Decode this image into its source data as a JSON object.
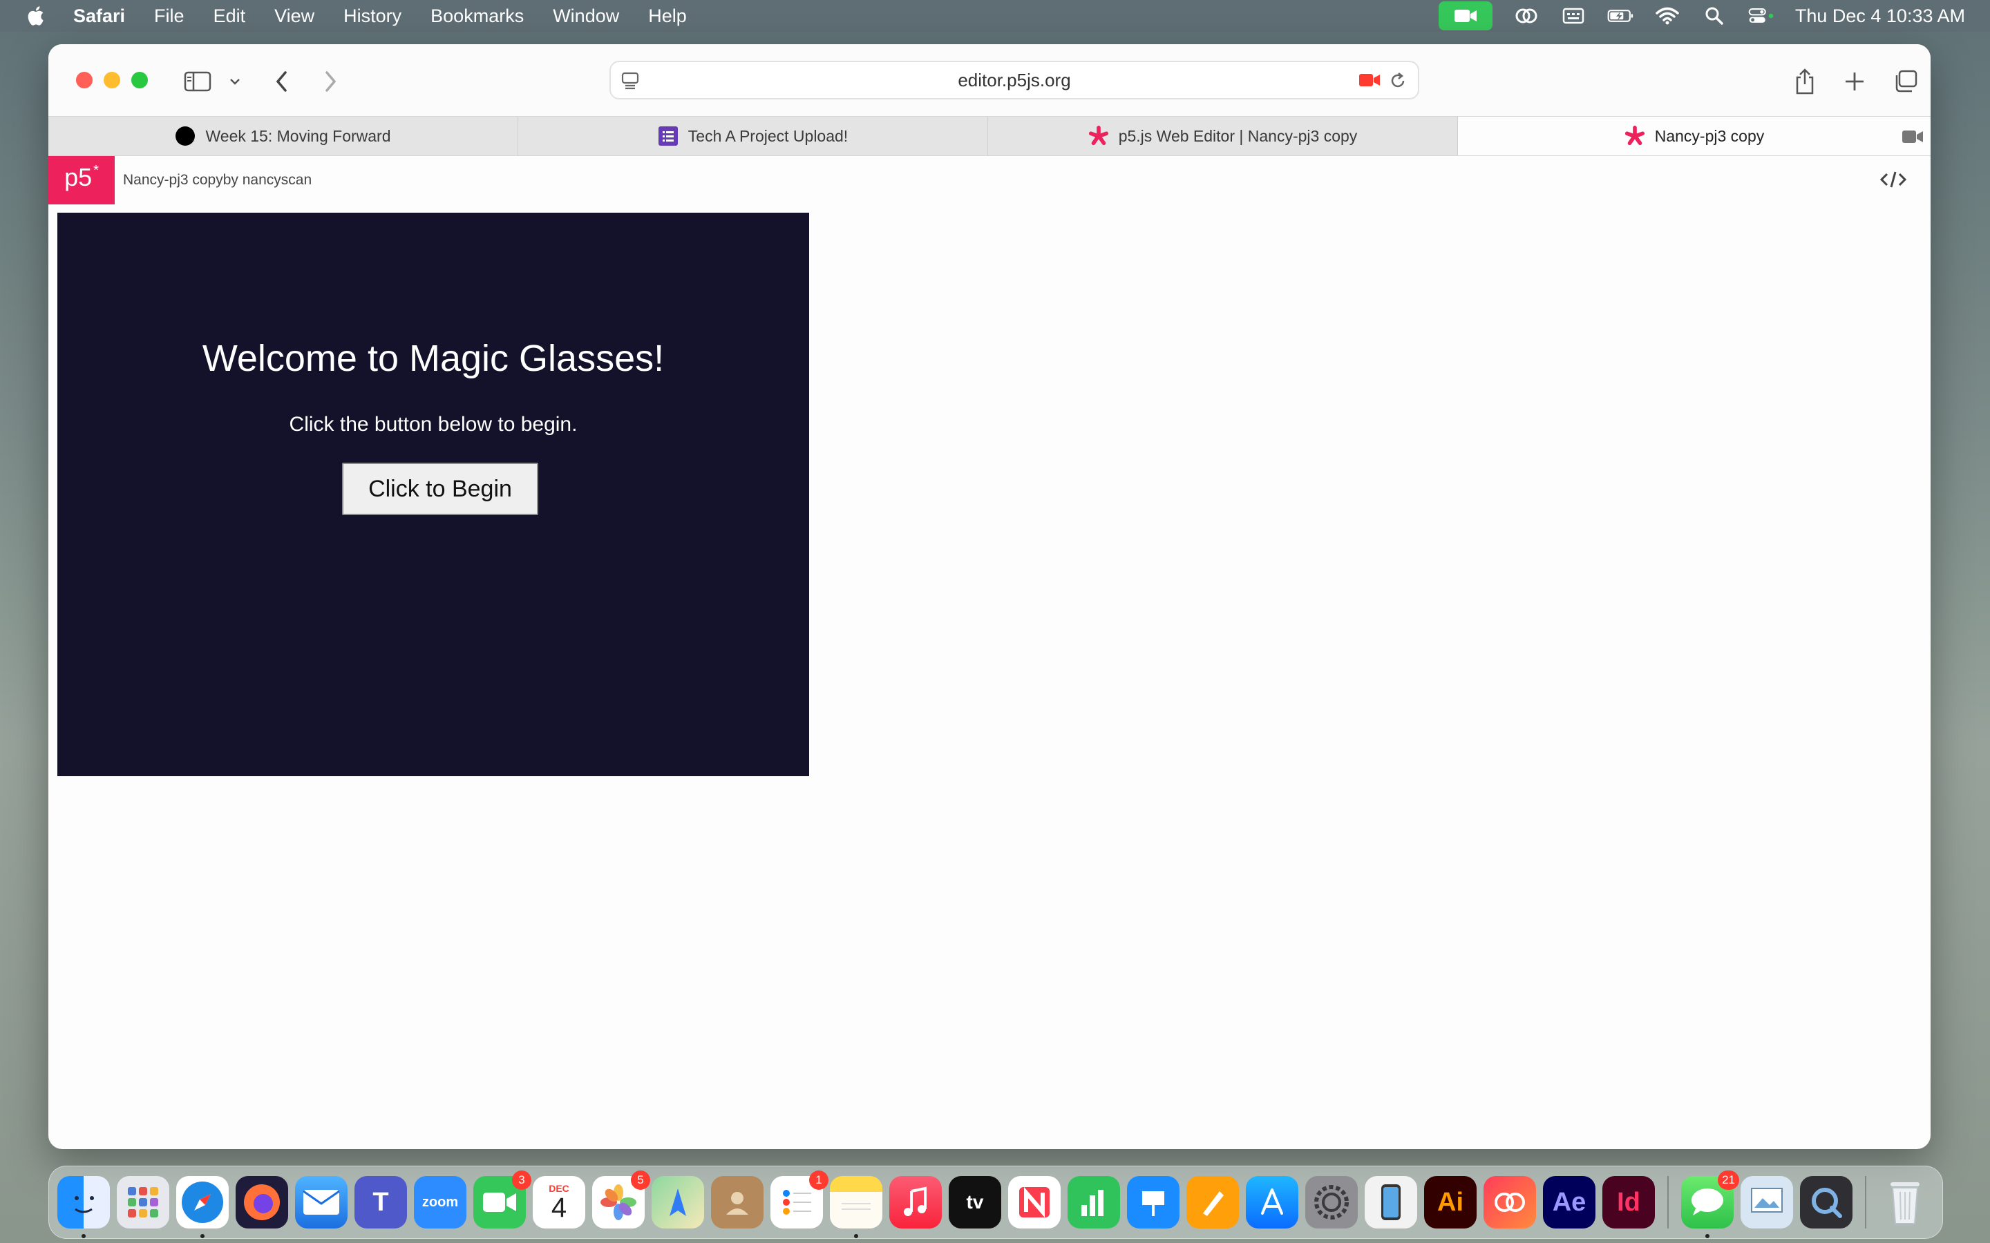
{
  "menubar": {
    "app": "Safari",
    "items": [
      "File",
      "Edit",
      "View",
      "History",
      "Bookmarks",
      "Window",
      "Help"
    ],
    "clock": "Thu Dec 4  10:33 AM"
  },
  "browser": {
    "url": "editor.p5js.org",
    "tabs": [
      {
        "title": "Week 15: Moving Forward",
        "icon": "black-circle-icon"
      },
      {
        "title": "Tech A Project Upload!",
        "icon": "forms-icon"
      },
      {
        "title": "p5.js Web Editor | Nancy-pj3 copy",
        "icon": "p5-asterisk-icon"
      },
      {
        "title": "Nancy-pj3 copy",
        "icon": "p5-asterisk-icon",
        "active": true
      }
    ]
  },
  "p5": {
    "logo": "p5",
    "logo_sup": "*",
    "title": "Nancy-pj3 copyby  nancyscan"
  },
  "sketch": {
    "heading": "Welcome to Magic Glasses!",
    "instruction": "Click the button below to begin.",
    "button_label": "Click to Begin"
  },
  "dock": {
    "apps": [
      {
        "name": "finder",
        "badge": ""
      },
      {
        "name": "launchpad",
        "badge": ""
      },
      {
        "name": "safari",
        "badge": ""
      },
      {
        "name": "firefox",
        "badge": ""
      },
      {
        "name": "mail",
        "badge": ""
      },
      {
        "name": "teams",
        "badge": ""
      },
      {
        "name": "zoom",
        "label": "zoom",
        "badge": ""
      },
      {
        "name": "facetime",
        "badge": "3"
      },
      {
        "name": "calendar",
        "month": "DEC",
        "day": "4",
        "badge": ""
      },
      {
        "name": "photos",
        "badge": "5"
      },
      {
        "name": "maps",
        "badge": ""
      },
      {
        "name": "contacts",
        "badge": ""
      },
      {
        "name": "reminders",
        "badge": "1"
      },
      {
        "name": "notes",
        "badge": ""
      },
      {
        "name": "music",
        "badge": ""
      },
      {
        "name": "apple-tv",
        "label": "tv",
        "badge": ""
      },
      {
        "name": "news",
        "badge": ""
      },
      {
        "name": "numbers",
        "badge": ""
      },
      {
        "name": "keynote",
        "badge": ""
      },
      {
        "name": "pages",
        "badge": ""
      },
      {
        "name": "app-store",
        "badge": ""
      },
      {
        "name": "system-settings",
        "badge": ""
      },
      {
        "name": "iphone-mirroring",
        "badge": ""
      },
      {
        "name": "illustrator",
        "label": "Ai",
        "badge": ""
      },
      {
        "name": "creative-cloud",
        "badge": ""
      },
      {
        "name": "after-effects",
        "label": "Ae",
        "badge": ""
      },
      {
        "name": "indesign",
        "label": "Id",
        "badge": ""
      },
      {
        "name": "messages",
        "badge": "21"
      },
      {
        "name": "preview",
        "badge": ""
      },
      {
        "name": "quicktime",
        "badge": ""
      },
      {
        "name": "trash",
        "badge": ""
      }
    ]
  }
}
